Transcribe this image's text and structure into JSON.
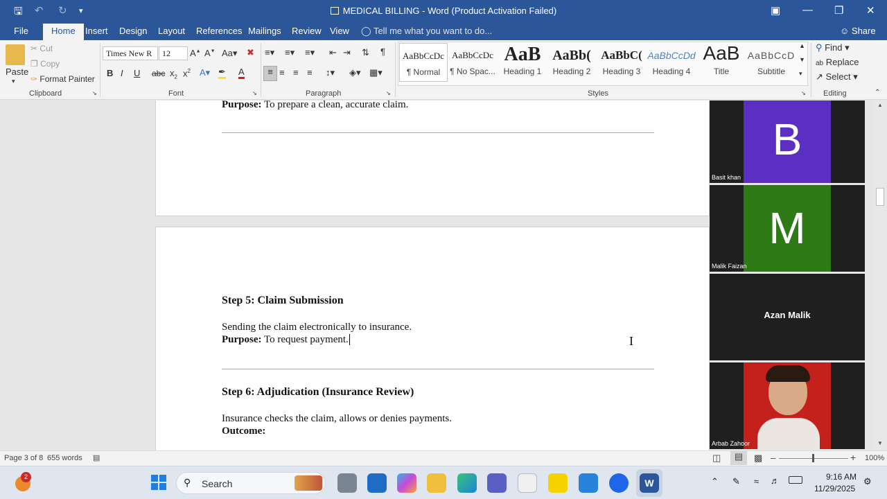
{
  "titlebar": {
    "title": "MEDICAL BILLING - Word (Product Activation Failed)",
    "save_icon": "save-icon",
    "undo_icon": "undo-icon",
    "redo_icon": "redo-icon"
  },
  "tabs": [
    "File",
    "Home",
    "Insert",
    "Design",
    "Layout",
    "References",
    "Mailings",
    "Review",
    "View"
  ],
  "tell_me": "Tell me what you want to do...",
  "share": "Share",
  "clipboard": {
    "paste": "Paste",
    "cut": "Cut",
    "copy": "Copy",
    "format_painter": "Format Painter",
    "label": "Clipboard"
  },
  "font": {
    "name": "Times New R",
    "size": "12",
    "label": "Font"
  },
  "paragraph": {
    "label": "Paragraph"
  },
  "styles": {
    "label": "Styles",
    "items": [
      {
        "preview": "AaBbCcDc",
        "name": "¶ Normal"
      },
      {
        "preview": "AaBbCcDc",
        "name": "¶ No Spac..."
      },
      {
        "preview": "AaB",
        "name": "Heading 1"
      },
      {
        "preview": "AaBb(",
        "name": "Heading 2"
      },
      {
        "preview": "AaBbC(",
        "name": "Heading 3"
      },
      {
        "preview": "AaBbCcDd",
        "name": "Heading 4"
      },
      {
        "preview": "AaB",
        "name": "Title"
      },
      {
        "preview": "AaBbCcD",
        "name": "Subtitle"
      }
    ]
  },
  "editing": {
    "find": "Find",
    "replace": "Replace",
    "select": "Select",
    "label": "Editing"
  },
  "document": {
    "purpose_top_label": "Purpose:",
    "purpose_top_text": " To prepare a clean, accurate claim.",
    "step5_heading": "Step 5: Claim Submission",
    "step5_body": "Sending the claim electronically to insurance.",
    "step5_purpose_label": "Purpose:",
    "step5_purpose_text": " To request payment.",
    "step6_heading": "Step 6: Adjudication (Insurance Review)",
    "step6_body": "Insurance checks the claim, allows or denies payments.",
    "step6_outcome_label": "Outcome:"
  },
  "participants": [
    {
      "name": "Basit khan",
      "initial": "B",
      "color": "#5b2fc2"
    },
    {
      "name": "Malik Faizan",
      "initial": "M",
      "color": "#2e7a16"
    },
    {
      "name": "Azan Malik",
      "initial": "",
      "color": "#1f1f1f"
    },
    {
      "name": "Arbab Zahoor",
      "initial": "",
      "color": "#c4201c"
    }
  ],
  "status": {
    "page": "Page 3 of 8",
    "words": "655 words",
    "zoom": "100%"
  },
  "taskbar": {
    "search": "Search",
    "time": "9:16 AM",
    "date": "11/29/2025",
    "badge": "2"
  }
}
